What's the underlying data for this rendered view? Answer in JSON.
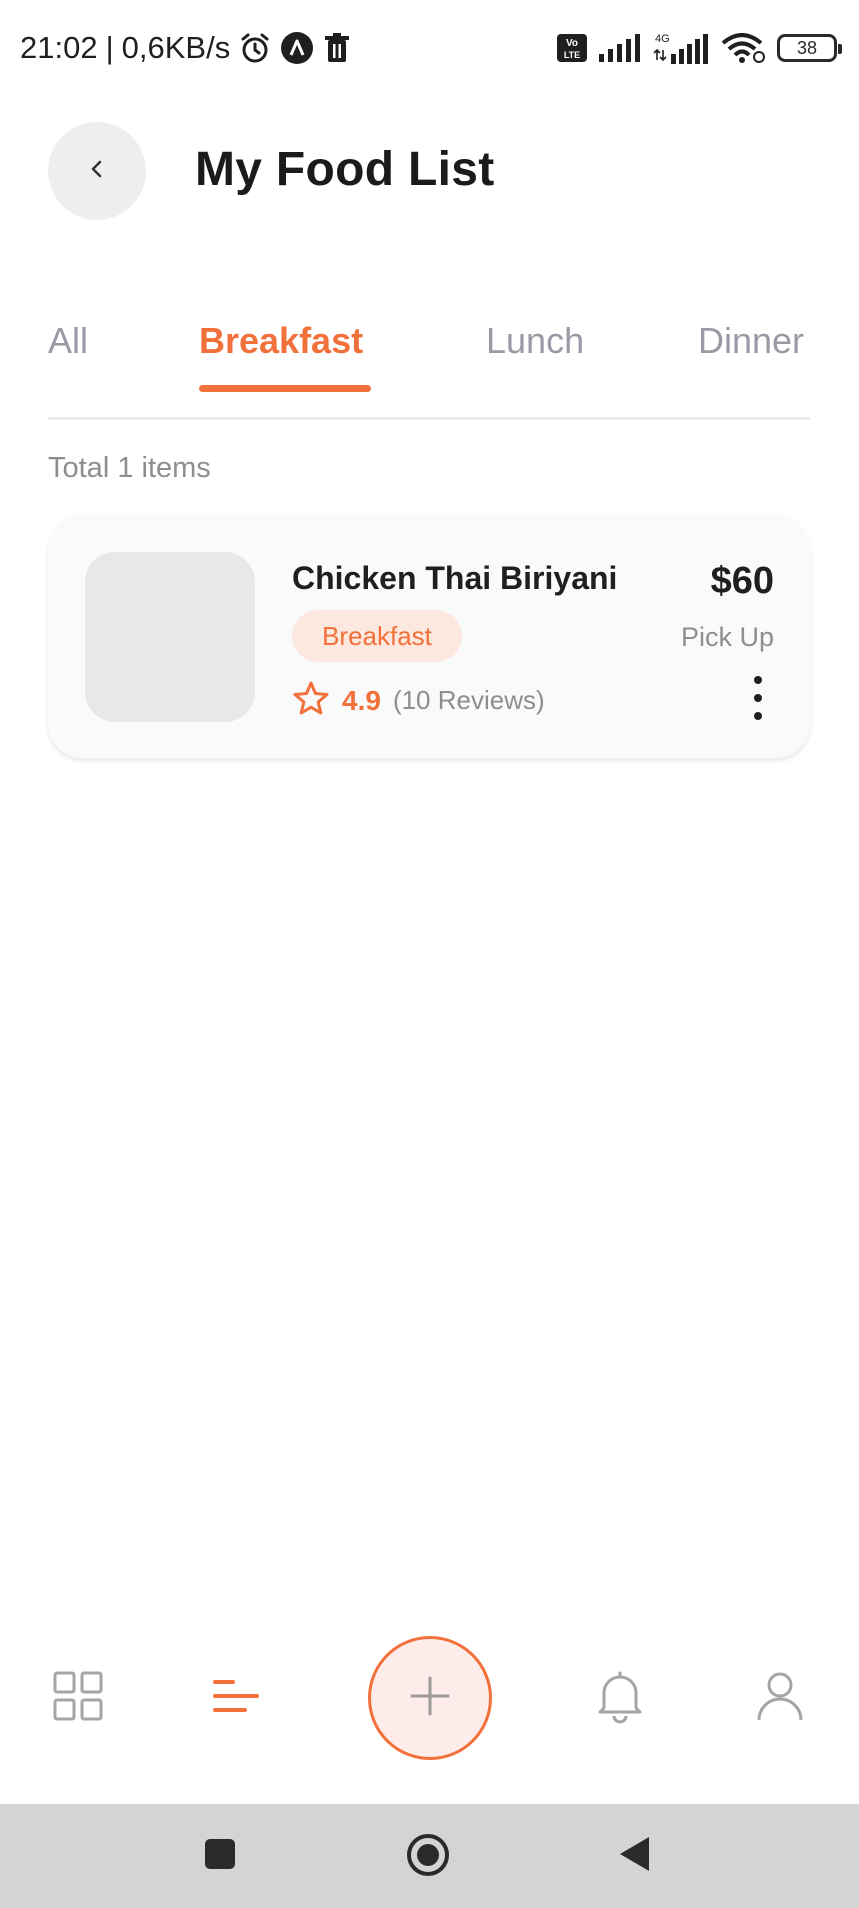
{
  "status_bar": {
    "time": "21:02",
    "separator": "|",
    "speed": "0,6KB/s",
    "network_badge": "Vo LTE",
    "network_type": "4G",
    "battery": "38"
  },
  "header": {
    "back_icon": "chevron-left-icon",
    "title": "My Food List"
  },
  "tabs": [
    {
      "label": "All",
      "active": false
    },
    {
      "label": "Breakfast",
      "active": true
    },
    {
      "label": "Lunch",
      "active": false
    },
    {
      "label": "Dinner",
      "active": false
    }
  ],
  "summary": {
    "total_label": "Total 1 items"
  },
  "food_items": [
    {
      "name": "Chicken Thai Biriyani",
      "category": "Breakfast",
      "rating": "4.9",
      "reviews": "(10 Reviews)",
      "price": "$60",
      "delivery_type": "Pick Up"
    }
  ],
  "bottom_nav": {
    "items": [
      "grid-icon",
      "list-icon",
      "plus-icon",
      "bell-icon",
      "user-icon"
    ],
    "active": "list-icon"
  },
  "colors": {
    "accent": "#f2703a",
    "accent_light": "#fde8df",
    "text_primary": "#1f1f1f",
    "text_muted": "#9a9aa4",
    "nav_inactive": "#a5a5a5",
    "system_nav_bg": "#d4d4d4"
  }
}
